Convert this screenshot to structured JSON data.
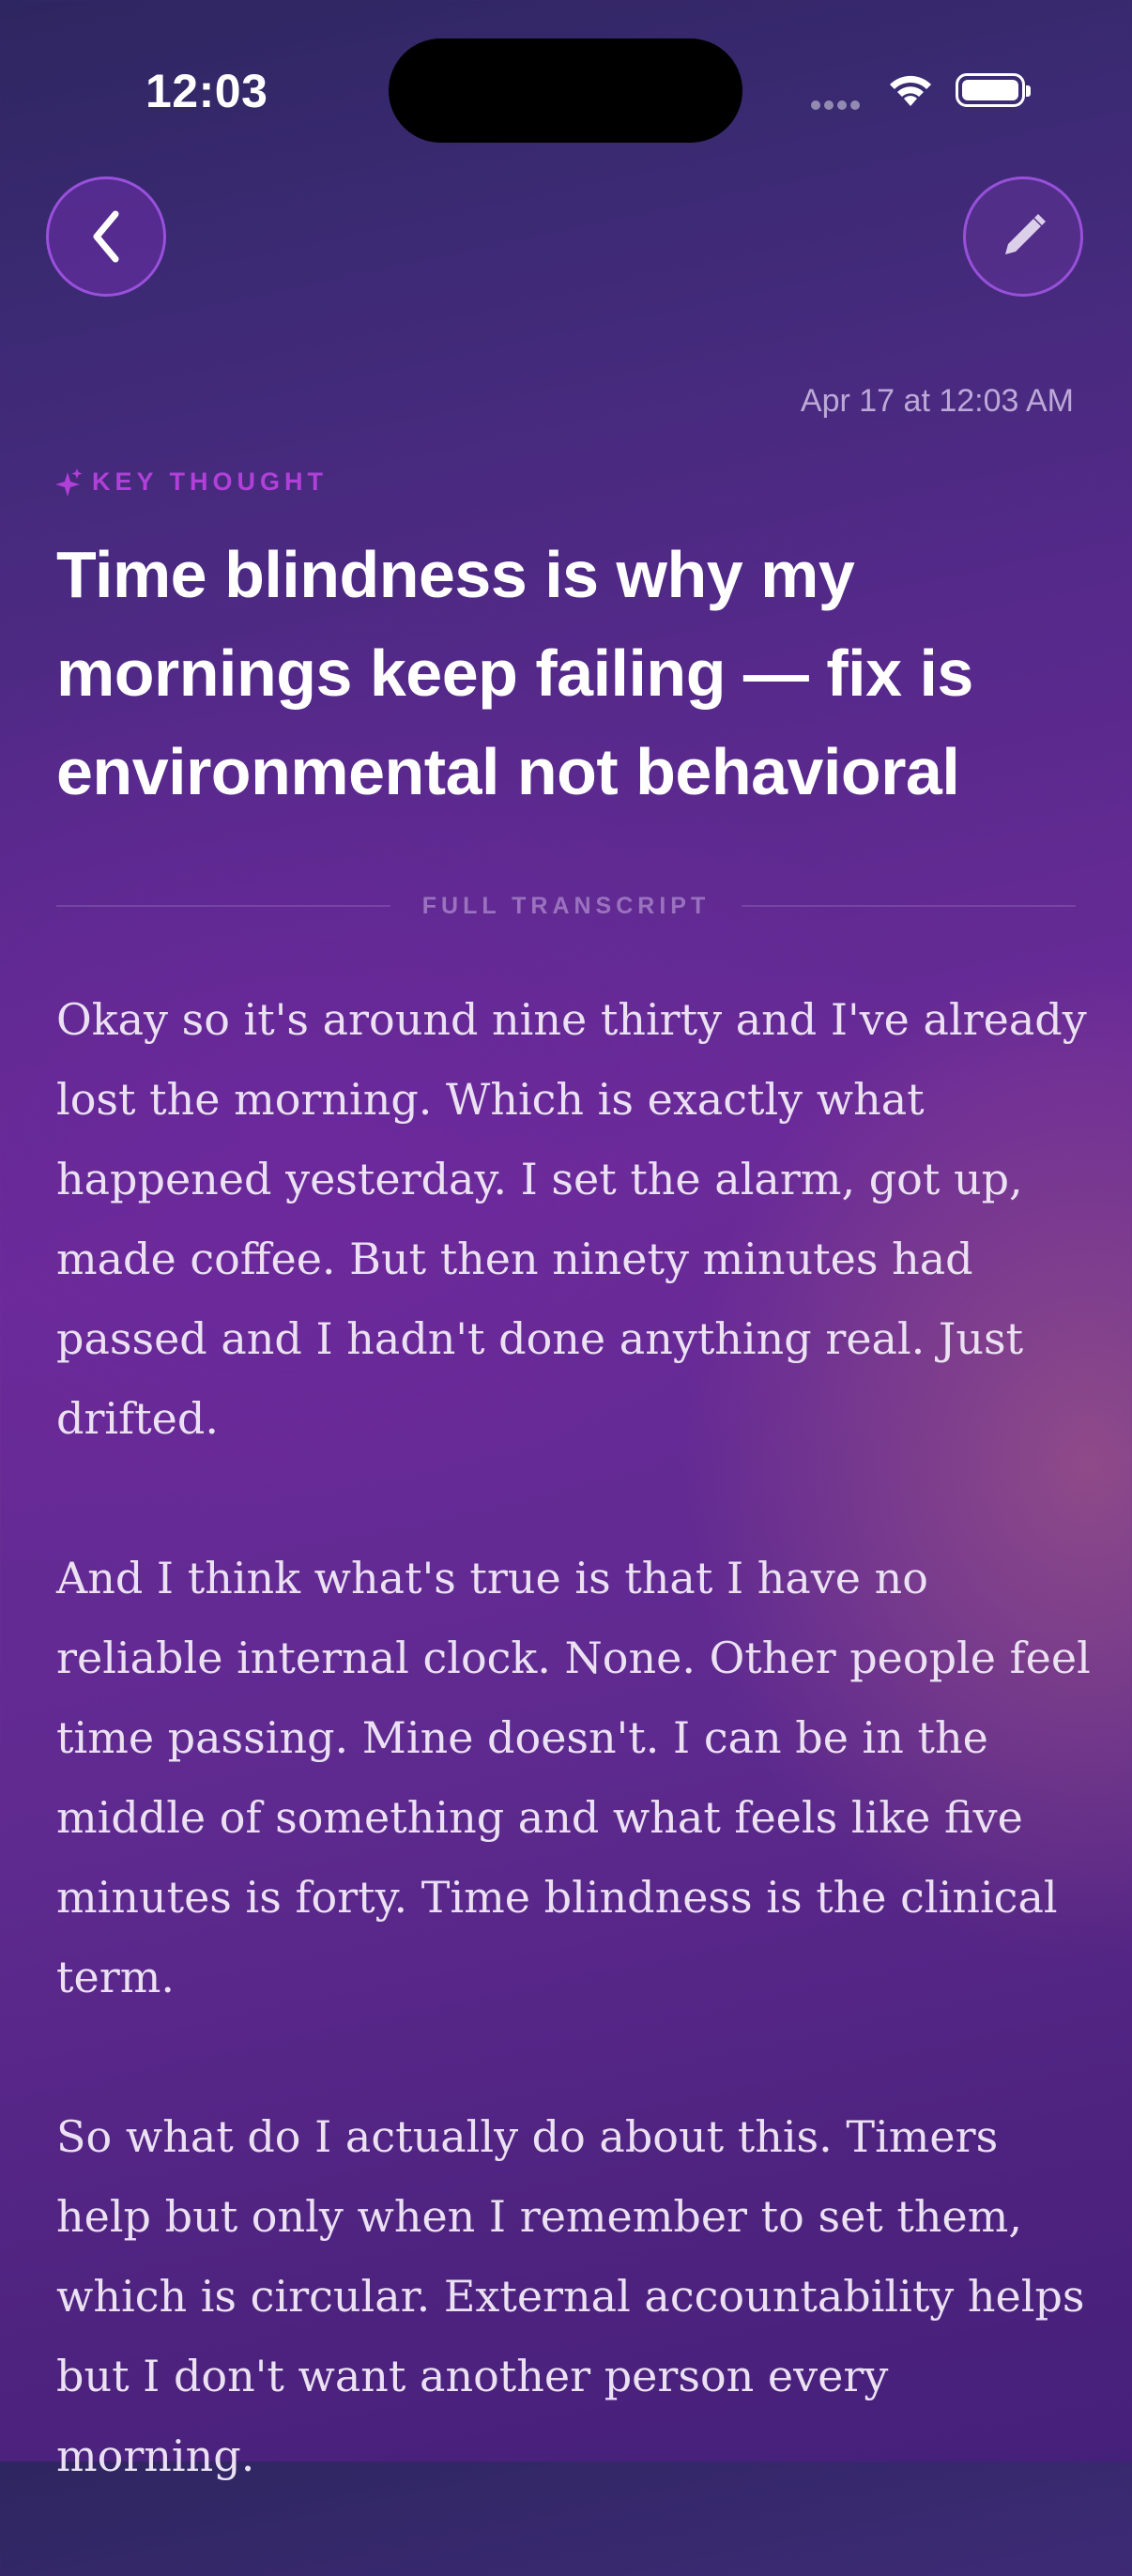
{
  "status_bar": {
    "time": "12:03"
  },
  "header": {
    "timestamp": "Apr 17 at 12:03 AM"
  },
  "note": {
    "tag": "KEY THOUGHT",
    "title": "Time blindness is why my mornings keep failing — fix is environmental not behavioral"
  },
  "transcript": {
    "label": "FULL TRANSCRIPT",
    "paragraphs": [
      "Okay so it's around nine thirty and I've already lost the morning. Which is exactly what happened yesterday. I set the alarm, got up, made coffee. But then ninety minutes had passed and I hadn't done anything real. Just drifted.",
      "And I think what's true is that I have no reliable internal clock. None. Other people feel time passing. Mine doesn't. I can be in the middle of something and what feels like five minutes is forty. Time blindness is the clinical term.",
      "So what do I actually do about this. Timers help but only when I remember to set them, which is circular. External accountability helps but I don't want another person every morning."
    ]
  },
  "icons": {
    "back": "chevron-left-icon",
    "edit": "pencil-icon",
    "tag": "sparkle-icon"
  },
  "colors": {
    "accent": "#b040d8",
    "button_border": "#aa5af0"
  }
}
